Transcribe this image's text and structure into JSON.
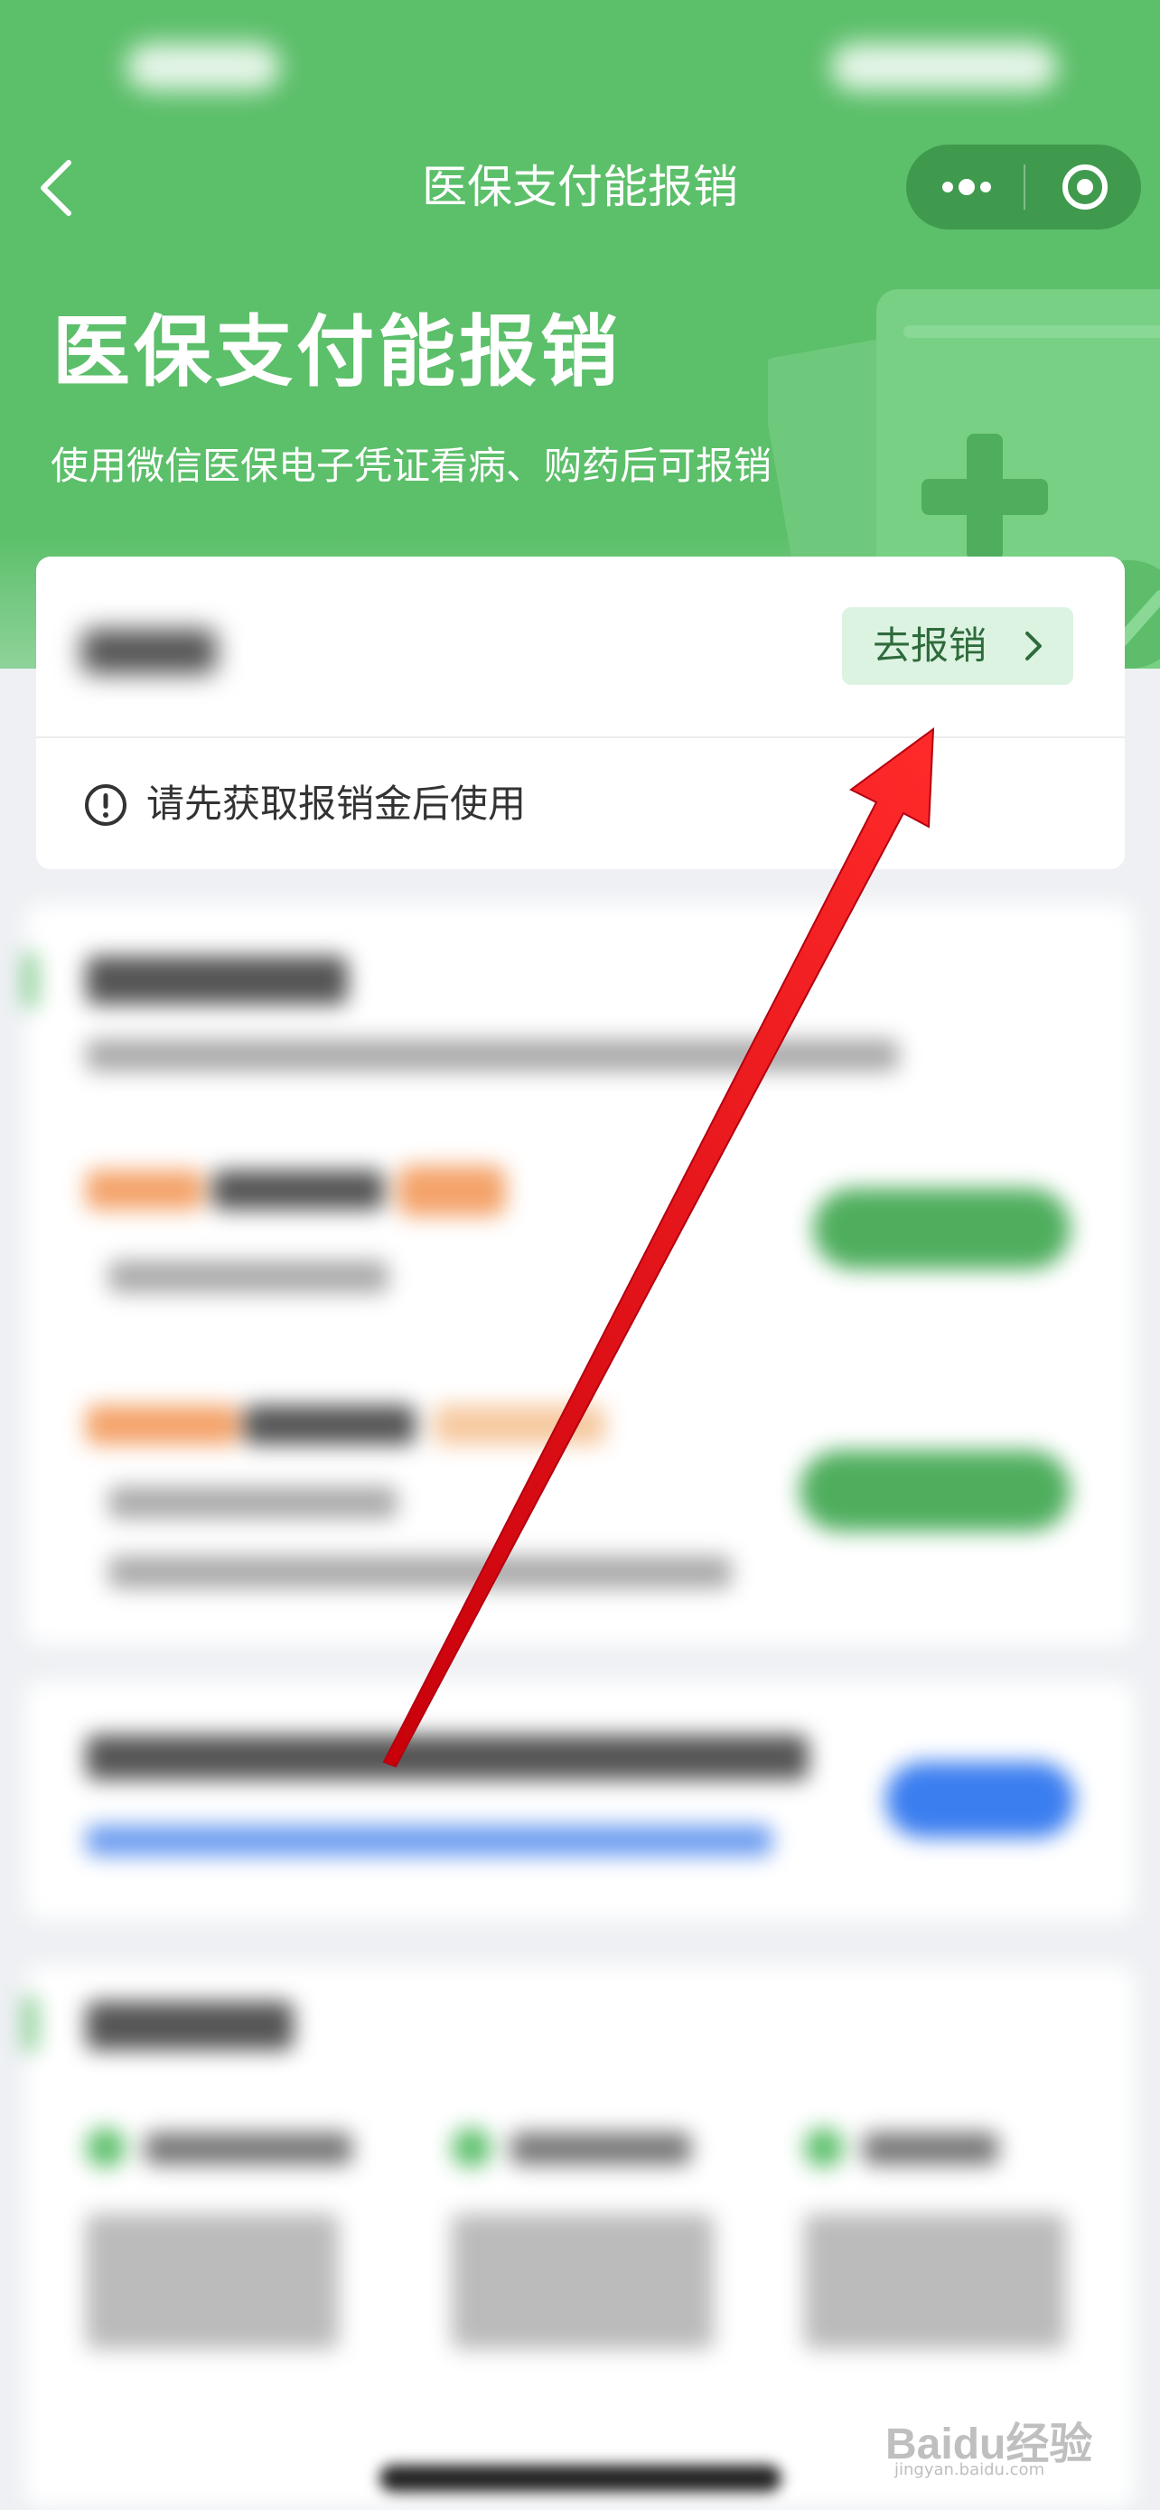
{
  "nav": {
    "title": "医保支付能报销",
    "back_icon": "chevron-left-icon",
    "more_icon": "more-dots-icon",
    "close_icon": "target-close-icon"
  },
  "hero": {
    "title": "医保支付能报销",
    "subtitle": "使用微信医保电子凭证看病、购药后可报销"
  },
  "card": {
    "button_label": "去报销",
    "button_icon": "chevron-right-icon",
    "notice_icon": "exclamation-circle-icon",
    "notice_text": "请先获取报销金后使用"
  },
  "watermark": {
    "brand": "Baidu经验",
    "url": "jingyan.baidu.com"
  },
  "colors": {
    "brand_green": "#5cbf6a",
    "button_bg": "#ddf3e2",
    "button_text": "#2e6b3b",
    "arrow_red": "#e8121b"
  }
}
